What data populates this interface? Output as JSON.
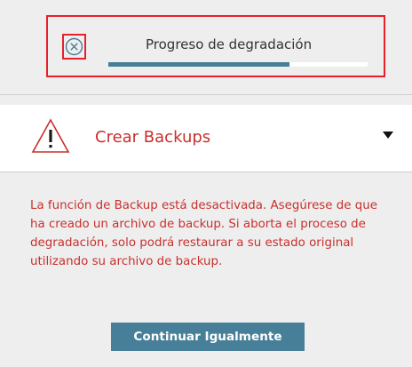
{
  "progress": {
    "label": "Progreso de degradación",
    "value_percent": 70,
    "cancel_icon": "close-circle-icon"
  },
  "section": {
    "title": "Crear Backups",
    "warning_icon": "warning-triangle-icon",
    "toggle_icon": "caret-down-icon"
  },
  "message": {
    "text": "La función de Backup está desactivada. Asegúrese de que ha creado un archivo de backup. Si aborta el proceso de degradación, solo podrá restaurar a su estado original utilizando su archivo de backup."
  },
  "actions": {
    "continue_label": "Continuar Igualmente"
  },
  "colors": {
    "accent": "#467f97",
    "warning_text": "#c8302c",
    "highlight": "#e8202a"
  }
}
